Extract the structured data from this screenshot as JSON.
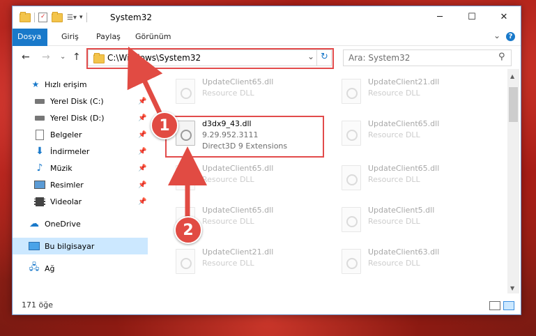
{
  "window": {
    "title": "System32",
    "min_icon": "─",
    "max_icon": "☐",
    "close_icon": "✕"
  },
  "ribbon": {
    "tabs": [
      "Dosya",
      "Giriş",
      "Paylaş",
      "Görünüm"
    ],
    "expand_icon": "⌄",
    "help_icon": "?"
  },
  "address": {
    "back": "←",
    "forward": "→",
    "recent": "⌄",
    "up": "↑",
    "path": "C:\\Windows\\System32",
    "dropdown": "⌄",
    "refresh": "↻",
    "search_placeholder": "Ara: System32",
    "search_icon": "⚲"
  },
  "sidebar": {
    "items": [
      {
        "label": "Hızlı erişim",
        "icon": "star-icon"
      },
      {
        "label": "Yerel Disk (C:)",
        "icon": "drive-icon",
        "pinned": true
      },
      {
        "label": "Yerel Disk (D:)",
        "icon": "drive-icon",
        "pinned": true
      },
      {
        "label": "Belgeler",
        "icon": "document-icon",
        "pinned": true
      },
      {
        "label": "İndirmeler",
        "icon": "download-icon",
        "pinned": true
      },
      {
        "label": "Müzik",
        "icon": "music-icon",
        "pinned": true
      },
      {
        "label": "Resimler",
        "icon": "picture-icon",
        "pinned": true
      },
      {
        "label": "Videolar",
        "icon": "video-icon",
        "pinned": true
      },
      {
        "label": "OneDrive",
        "icon": "cloud-icon"
      },
      {
        "label": "Bu bilgisayar",
        "icon": "computer-icon",
        "selected": true
      },
      {
        "label": "Ağ",
        "icon": "network-icon"
      }
    ]
  },
  "files": [
    {
      "name": "UpdateClient65.dll",
      "type": "Resource DLL"
    },
    {
      "name": "UpdateClient21.dll",
      "type": "Resource DLL"
    },
    {
      "name": "d3dx9_43.dll",
      "version": "9.29.952.3111",
      "description": "Direct3D 9 Extensions",
      "highlighted": true
    },
    {
      "name": "UpdateClient65.dll",
      "type": "Resource DLL"
    },
    {
      "name": "UpdateClient65.dll",
      "type": "Resource DLL"
    },
    {
      "name": "UpdateClient65.dll",
      "type": "Resource DLL"
    },
    {
      "name": "UpdateClient65.dll",
      "type": "Resource DLL"
    },
    {
      "name": "UpdateClient5.dll",
      "type": "Resource DLL"
    },
    {
      "name": "UpdateClient21.dll",
      "type": "Resource DLL"
    },
    {
      "name": "UpdateClient63.dll",
      "type": "Resource DLL"
    }
  ],
  "status": {
    "count": "171 öğe"
  },
  "annotations": {
    "badge1": "1",
    "badge2": "2",
    "color": "#e14b43"
  }
}
